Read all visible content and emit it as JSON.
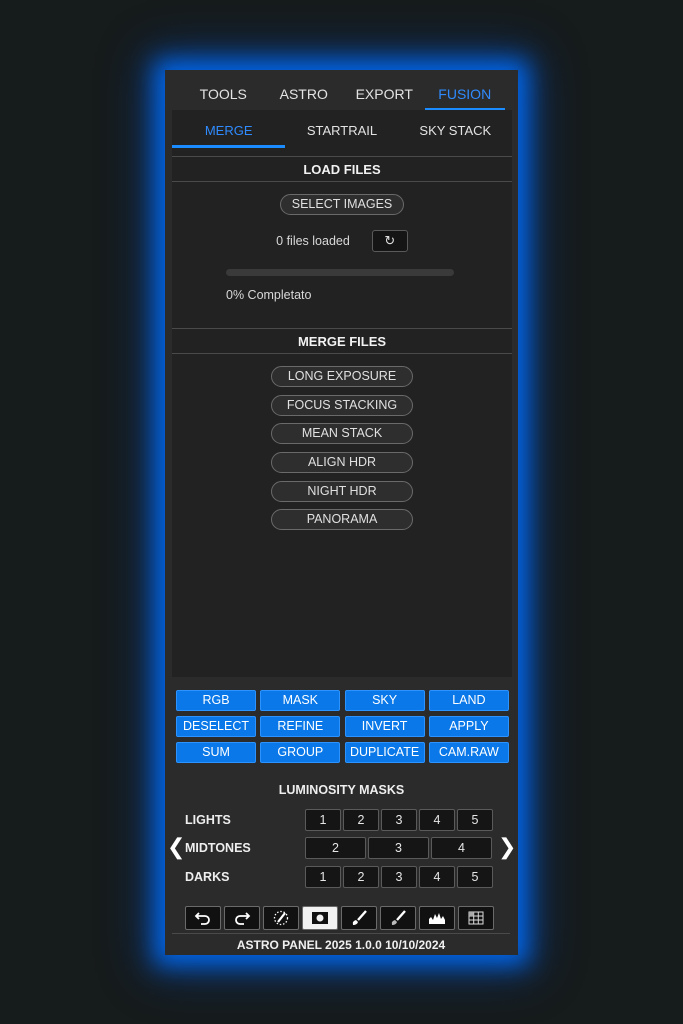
{
  "top_tabs": [
    "TOOLS",
    "ASTRO",
    "EXPORT",
    "FUSION"
  ],
  "active_top_tab": "FUSION",
  "sub_tabs": [
    "MERGE",
    "STARTRAIL",
    "SKY STACK"
  ],
  "active_sub_tab": "MERGE",
  "load_files": {
    "header": "LOAD FILES",
    "select_button": "SELECT IMAGES",
    "files_loaded": "0 files loaded",
    "refresh_icon": "refresh-icon",
    "progress_percent": 0,
    "progress_text": "0% Completato"
  },
  "merge_files": {
    "header": "MERGE FILES",
    "buttons": [
      "LONG EXPOSURE",
      "FOCUS STACKING",
      "MEAN STACK",
      "ALIGN HDR",
      "NIGHT HDR",
      "PANORAMA"
    ]
  },
  "tool_buttons": [
    "RGB",
    "MASK",
    "SKY",
    "LAND",
    "DESELECT",
    "REFINE",
    "INVERT",
    "APPLY",
    "SUM",
    "GROUP",
    "DUPLICATE",
    "CAM.RAW"
  ],
  "luminosity": {
    "title": "LUMINOSITY MASKS",
    "lights": {
      "label": "LIGHTS",
      "values": [
        "1",
        "2",
        "3",
        "4",
        "5"
      ]
    },
    "midtones": {
      "label": "MIDTONES",
      "values": [
        "2",
        "3",
        "4"
      ]
    },
    "darks": {
      "label": "DARKS",
      "values": [
        "1",
        "2",
        "3",
        "4",
        "5"
      ]
    }
  },
  "bottom_icons": [
    "undo-icon",
    "redo-icon",
    "dotted-brush-icon",
    "camera-icon",
    "brush-icon",
    "brush-dark-icon",
    "histogram-icon",
    "grid-icon"
  ],
  "footer": "ASTRO PANEL 2025 1.0.0 10/10/2024",
  "colors": {
    "accent": "#1a8cff",
    "button_blue": "#0a78e8",
    "panel_bg": "#2b2b2b",
    "content_bg": "#222222",
    "glow": "#006eff"
  }
}
